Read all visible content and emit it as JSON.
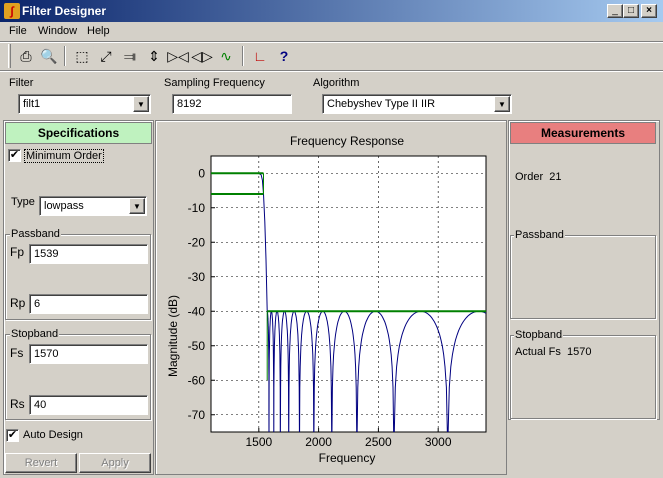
{
  "window": {
    "title": "Filter Designer"
  },
  "menu": [
    "File",
    "Window",
    "Help"
  ],
  "toolbar": [
    "print-icon",
    "print-preview-icon",
    "zoom-box-icon",
    "fit-icon",
    "zoom-y-in-icon",
    "zoom-y-out-icon",
    "zoom-x-in-icon",
    "zoom-x-out-icon",
    "full-view-icon",
    "filter-response-icon",
    "whats-this-icon"
  ],
  "filter": {
    "label": "Filter",
    "value": "filt1"
  },
  "sampling": {
    "label": "Sampling Frequency",
    "value": "8192"
  },
  "algorithm": {
    "label": "Algorithm",
    "value": "Chebyshev Type II IIR"
  },
  "specs": {
    "header": "Specifications",
    "header_color": "#bff2bf",
    "min_order_label": "Minimum Order",
    "min_order_checked": true,
    "type_label": "Type",
    "type_value": "lowpass",
    "passband_title": "Passband",
    "fp_label": "Fp",
    "fp_value": "1539",
    "rp_label": "Rp",
    "rp_value": "6",
    "stopband_title": "Stopband",
    "fs_label": "Fs",
    "fs_value": "1570",
    "rs_label": "Rs",
    "rs_value": "40",
    "auto_design_label": "Auto Design",
    "auto_design_checked": true,
    "revert_label": "Revert",
    "apply_label": "Apply"
  },
  "measurements": {
    "header": "Measurements",
    "header_color": "#e87f7f",
    "order_text": "Order  21",
    "passband_title": "Passband",
    "stopband_title": "Stopband",
    "actual_fs_text": "Actual Fs  1570"
  },
  "chart_data": {
    "type": "line",
    "title": "Frequency Response",
    "xlabel": "Frequency",
    "ylabel": "Magnitude (dB)",
    "xlim": [
      1100,
      3400
    ],
    "ylim": [
      -75,
      5
    ],
    "xticks": [
      1500,
      2000,
      2500,
      3000
    ],
    "yticks": [
      0,
      -10,
      -20,
      -30,
      -40,
      -50,
      -60,
      -70
    ],
    "grid": true,
    "colors": {
      "response": "#000080",
      "spec": "#008000"
    },
    "spec_lines": [
      {
        "x": [
          1100,
          1539
        ],
        "y": [
          0,
          0
        ]
      },
      {
        "x": [
          1100,
          1539
        ],
        "y": [
          -6,
          -6
        ]
      },
      {
        "x": [
          1570,
          3400
        ],
        "y": [
          -40,
          -40
        ]
      }
    ],
    "response_nulls": [
      1585,
      1625,
      1680,
      1750,
      1840,
      1960,
      2110,
      2320,
      2630,
      3080
    ],
    "response_passband": {
      "x": [
        1100,
        1500,
        1520,
        1530,
        1539,
        1550,
        1560,
        1570
      ],
      "y": [
        0,
        0,
        -0.5,
        -2,
        -6,
        -14,
        -25,
        -40
      ]
    }
  }
}
